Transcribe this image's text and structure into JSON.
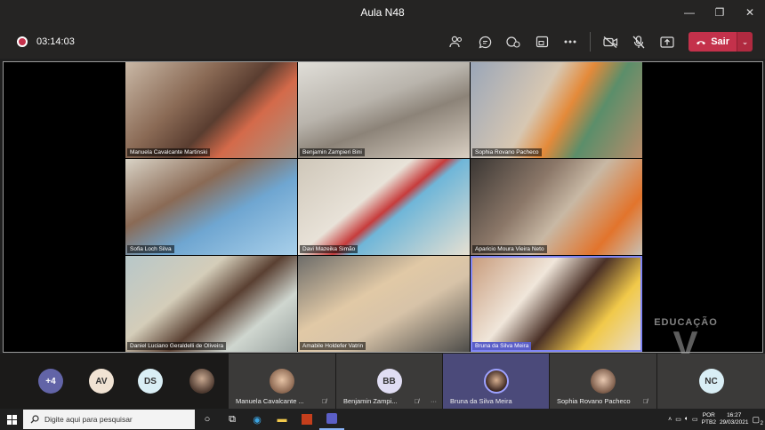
{
  "window": {
    "title": "Aula N48",
    "minimize": "—",
    "restore": "❐",
    "close": "✕"
  },
  "toolbar": {
    "timer": "03:14:03",
    "leave_label": "Sair"
  },
  "tiles": [
    {
      "name": "Manuela Cavalcante Martinski"
    },
    {
      "name": "Benjamin Zampieri Bini"
    },
    {
      "name": "Sophia Rovano Pacheco"
    },
    {
      "name": "Sofia Loch Silva"
    },
    {
      "name": "Davi Mazeika Simão"
    },
    {
      "name": "Aparicio Moura Vieira Neto"
    },
    {
      "name": "Daniel Luciano Geraldelli de Oliveira"
    },
    {
      "name": "Amabile Holdefer Vatrin"
    },
    {
      "name": "Bruna da Silva Meira"
    }
  ],
  "watermark": {
    "text": "EDUCAÇÃO",
    "letter": "V"
  },
  "roster": {
    "overflow": "+4",
    "initials": [
      "AV",
      "DS"
    ],
    "people": [
      {
        "label": "Manuela Cavalcante ..."
      },
      {
        "label": "Benjamin Zampi...",
        "initials": "BB",
        "more": "···"
      },
      {
        "label": "Bruna da Silva Meira"
      },
      {
        "label": "Sophia Rovano Pacheco"
      },
      {
        "initials": "NC"
      }
    ]
  },
  "taskbar": {
    "search_placeholder": "Digite aqui para pesquisar",
    "lang": "POR",
    "layout": "PTB2",
    "time": "16:27",
    "date": "29/03/2021",
    "notifications": "2"
  },
  "colors": {
    "leave": "#c4314b",
    "active_speaker": "#5b5fc7"
  }
}
